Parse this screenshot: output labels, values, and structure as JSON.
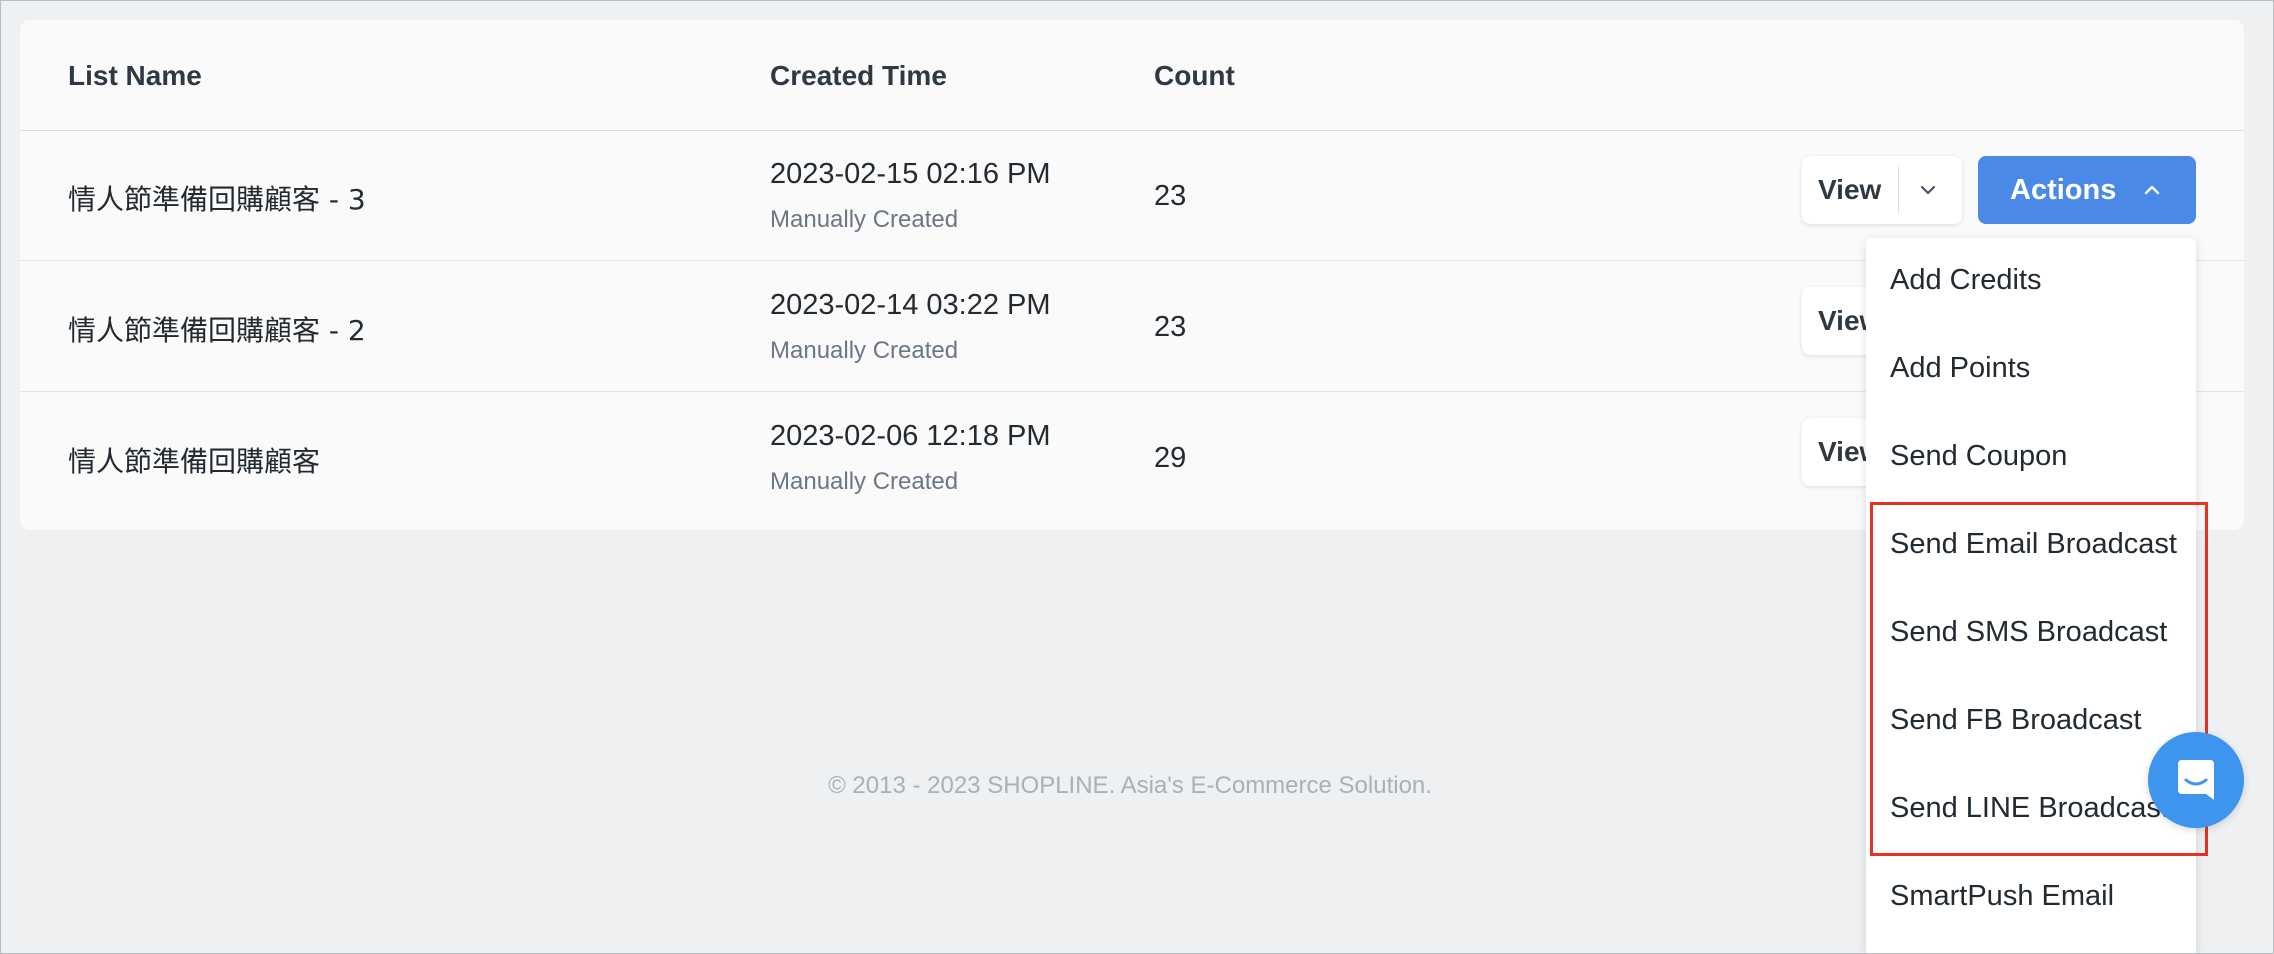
{
  "table": {
    "headers": {
      "list_name": "List Name",
      "created_time": "Created Time",
      "count": "Count"
    },
    "rows": [
      {
        "name": "情人節準備回購顧客 - 3",
        "created": "2023-02-15 02:16 PM",
        "origin": "Manually Created",
        "count": "23",
        "view_label": "View",
        "actions_label": "Actions"
      },
      {
        "name": "情人節準備回購顧客 - 2",
        "created": "2023-02-14 03:22 PM",
        "origin": "Manually Created",
        "count": "23",
        "view_label": "View"
      },
      {
        "name": "情人節準備回購顧客",
        "created": "2023-02-06 12:18 PM",
        "origin": "Manually Created",
        "count": "29",
        "view_label": "View"
      }
    ]
  },
  "actions_menu": {
    "items": [
      "Add Credits",
      "Add Points",
      "Send Coupon",
      "Send Email Broadcast",
      "Send SMS Broadcast",
      "Send FB Broadcast",
      "Send LINE Broadcast",
      "SmartPush Email"
    ]
  },
  "footer": {
    "text": "© 2013 - 2023 SHOPLINE. Asia's E-Commerce Solution."
  },
  "icons": {
    "view_dropdown": "chevron-down-icon",
    "actions_toggle": "chevron-up-icon",
    "chat": "chat-icon"
  },
  "colors": {
    "primary": "#4a8ae6",
    "highlight": "#e53223",
    "chat": "#3e95ee"
  }
}
